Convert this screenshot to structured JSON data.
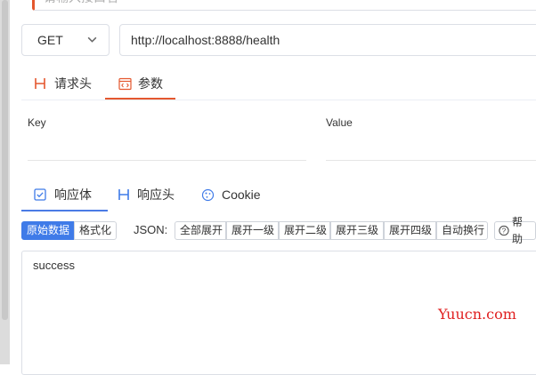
{
  "request": {
    "name_placeholder": "请输入接口名",
    "method": "GET",
    "url": "http://localhost:8888/health"
  },
  "request_tabs": [
    {
      "label": "请求头",
      "icon": "header-icon"
    },
    {
      "label": "参数",
      "icon": "code-icon",
      "active": true
    }
  ],
  "params_table": {
    "key_header": "Key",
    "value_header": "Value"
  },
  "response_tabs": [
    {
      "label": "响应体",
      "icon": "checkbox-icon",
      "active": true
    },
    {
      "label": "响应头",
      "icon": "header-icon"
    },
    {
      "label": "Cookie",
      "icon": "cookie-icon"
    }
  ],
  "toolbar": {
    "raw": "原始数据",
    "format": "格式化",
    "json_label": "JSON:",
    "expand_all": "全部展开",
    "expand_1": "展开一级",
    "expand_2": "展开二级",
    "expand_3": "展开三级",
    "expand_4": "展开四级",
    "wrap": "自动换行",
    "help": "帮助"
  },
  "response_body": "success",
  "watermark": "Yuucn.com",
  "colors": {
    "accent_orange": "#e4572e",
    "accent_blue": "#3f7be8"
  }
}
